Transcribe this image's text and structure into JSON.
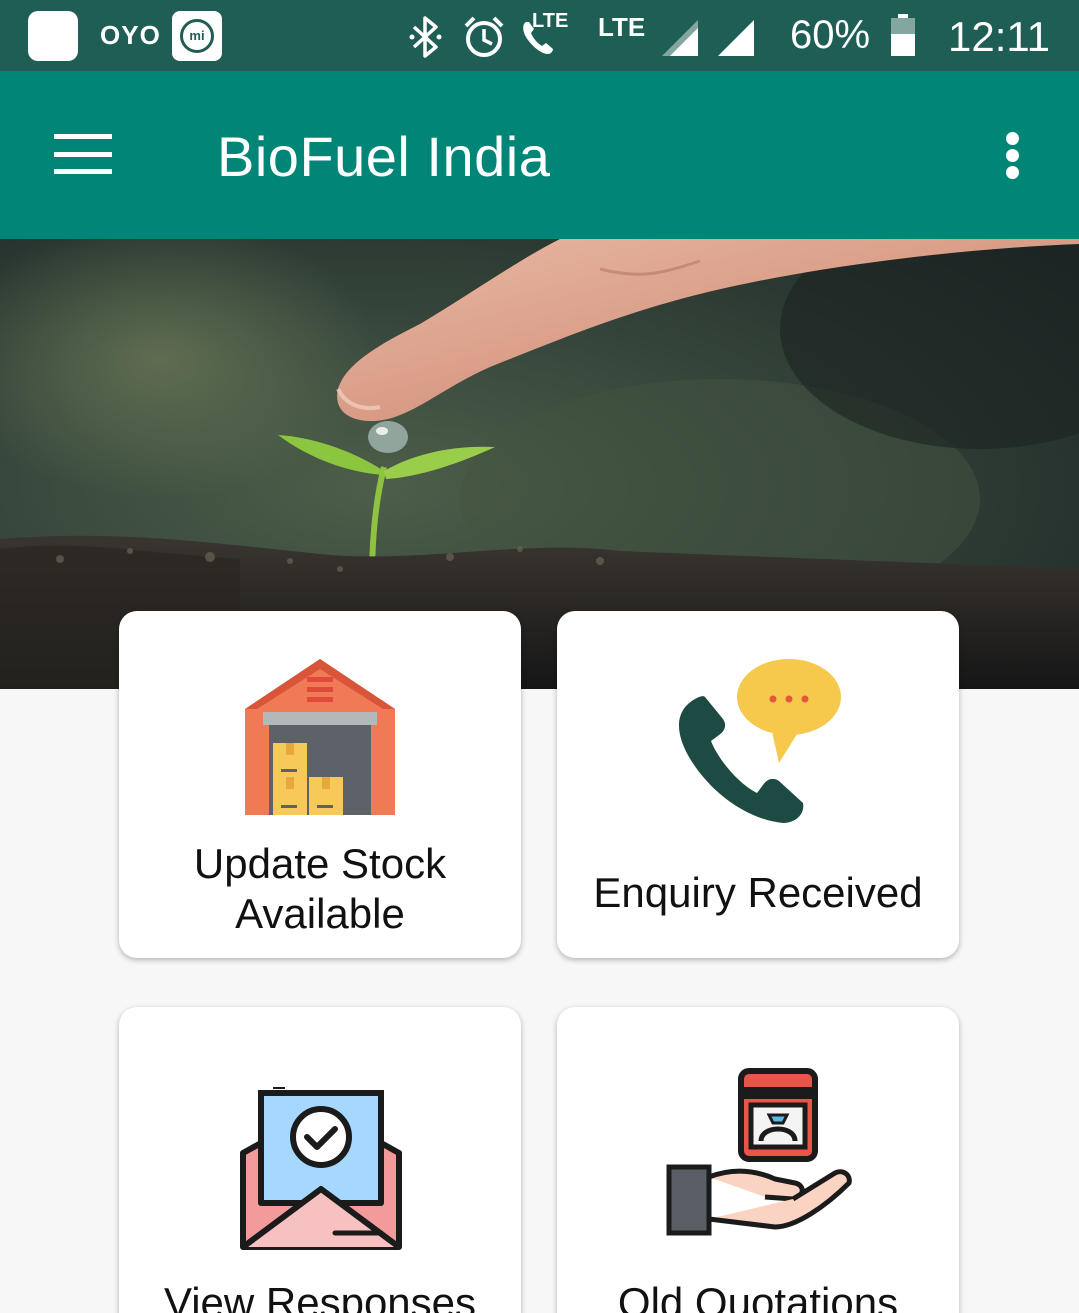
{
  "status_bar": {
    "carrier_label": "OYO",
    "mi_label": "mi",
    "lte_small": "LTE",
    "lte_large": "LTE",
    "battery": "60%",
    "time": "12:11"
  },
  "app_bar": {
    "title": "BioFuel India"
  },
  "tiles": [
    {
      "label_line1": "Update Stock",
      "label_line2": "Available",
      "icon": "warehouse-icon"
    },
    {
      "label": "Enquiry Received",
      "icon": "phone-chat-icon"
    },
    {
      "label": "View Responses",
      "icon": "envelope-check-icon"
    },
    {
      "label": "Old Quotations",
      "icon": "hand-ring-box-icon"
    }
  ],
  "colors": {
    "status_bar": "#1f5e55",
    "app_bar": "#008577",
    "background": "#f7f7f7"
  }
}
